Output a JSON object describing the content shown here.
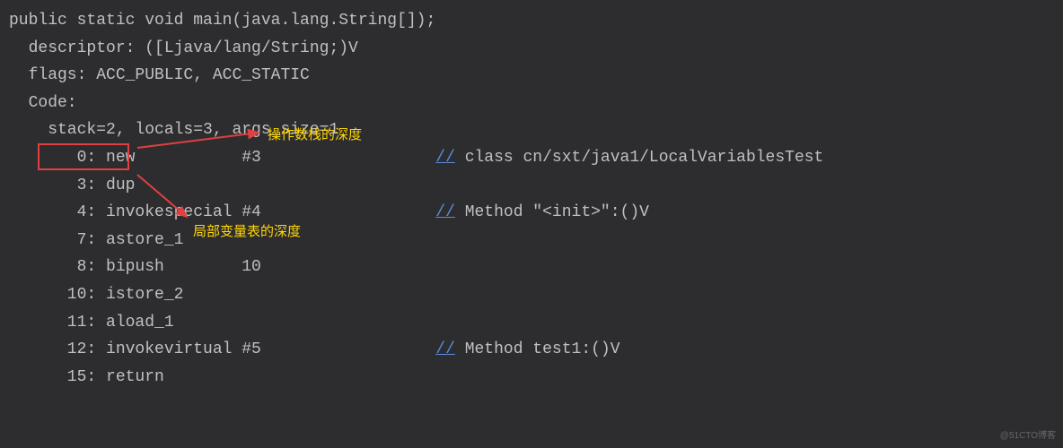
{
  "code": {
    "line1": "public static void main(java.lang.String[]);",
    "line2": "  descriptor: ([Ljava/lang/String;)V",
    "line3": "  flags: ACC_PUBLIC, ACC_STATIC",
    "line4": "  Code:",
    "line5": "    stack=2, locals=3, args_size=1",
    "line6_offset": "       0: new           #3                  ",
    "line6_comment": " class cn/sxt/java1/LocalVariablesTest",
    "line7": "       3: dup",
    "line8_offset": "       4: invokespecial #4                  ",
    "line8_comment": " Method \"<init>\":()V",
    "line9": "       7: astore_1",
    "line10": "       8: bipush        10",
    "line11": "      10: istore_2",
    "line12": "      11: aload_1",
    "line13_offset": "      12: invokevirtual #5                  ",
    "line13_comment": " Method test1:()V",
    "line14": "      15: return"
  },
  "annotations": {
    "operand_stack": "操作数栈的深度",
    "local_vars": "局部变量表的深度"
  },
  "comment_prefix": "//",
  "watermark": "@51CTO博客"
}
